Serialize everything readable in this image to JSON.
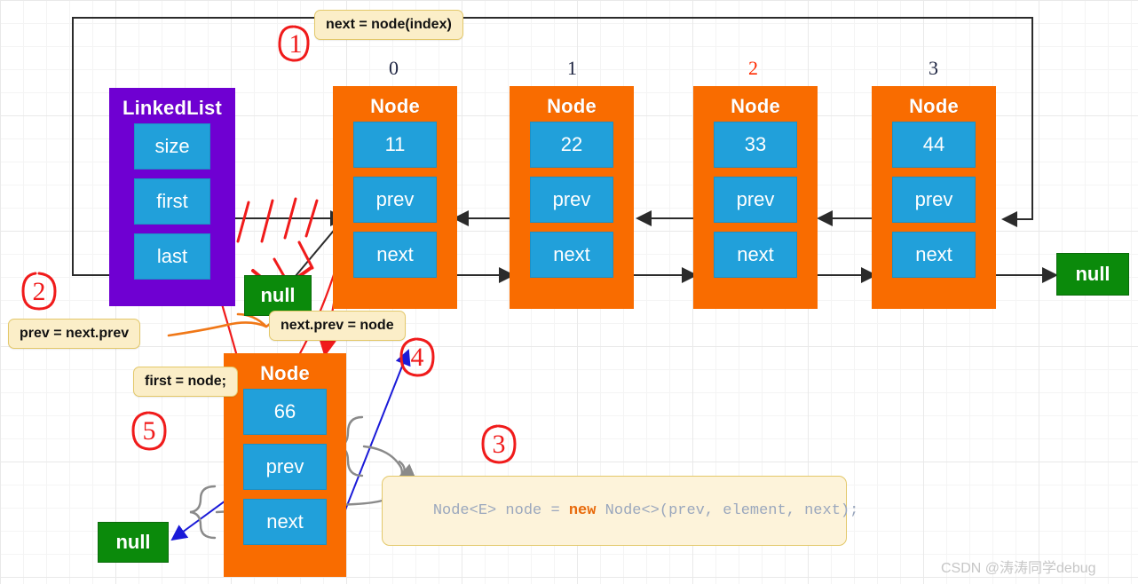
{
  "diagram": {
    "title": "LinkedList add(index, element) doubly-linked list diagram",
    "colors": {
      "linkedlist_box": "#6f00d2",
      "node_box": "#f96c00",
      "field_box": "#21a0da",
      "null_box": "#0b8a0b",
      "note_bg": "#fbeec8",
      "note_border": "#e3c86a",
      "hand_mark": "#f01b1b",
      "highlight_index": "#ff2a00",
      "blue_arrow": "#1a1ad8",
      "orange_arrow": "#f07818",
      "gray_arrow": "#7a7a7a"
    }
  },
  "linkedlist": {
    "title": "LinkedList",
    "fields": [
      {
        "label": "size"
      },
      {
        "label": "first"
      },
      {
        "label": "last"
      }
    ]
  },
  "indices": [
    {
      "label": "0",
      "highlight": false
    },
    {
      "label": "1",
      "highlight": false
    },
    {
      "label": "2",
      "highlight": true
    },
    {
      "label": "3",
      "highlight": false
    }
  ],
  "nodes": [
    {
      "title": "Node",
      "value": "11",
      "prev_label": "prev",
      "next_label": "next"
    },
    {
      "title": "Node",
      "value": "22",
      "prev_label": "prev",
      "next_label": "next"
    },
    {
      "title": "Node",
      "value": "33",
      "prev_label": "prev",
      "next_label": "next"
    },
    {
      "title": "Node",
      "value": "44",
      "prev_label": "prev",
      "next_label": "next"
    }
  ],
  "new_node": {
    "title": "Node",
    "value": "66",
    "prev_label": "prev",
    "next_label": "next"
  },
  "null_boxes": [
    {
      "label": "null",
      "name": "null-right"
    },
    {
      "label": "null",
      "name": "null-crossed-out"
    },
    {
      "label": "null",
      "name": "null-bottom-left"
    }
  ],
  "notes": [
    {
      "text": "next = node(index)",
      "name": "note-next-node-index"
    },
    {
      "text": "prev = next.prev",
      "name": "note-prev-next-prev"
    },
    {
      "text": "next.prev = node",
      "name": "note-next-prev-node"
    },
    {
      "text": "first = node;",
      "name": "note-first-node"
    }
  ],
  "code": {
    "parts": [
      {
        "text": "Node<E>",
        "style": "type"
      },
      {
        "text": " node ",
        "style": "plain"
      },
      {
        "text": "= ",
        "style": "plain"
      },
      {
        "text": "new",
        "style": "kw"
      },
      {
        "text": " Node<>(prev, element, next);",
        "style": "plain"
      }
    ],
    "full": "Node<E> node = new Node<>(prev, element, next);"
  },
  "hand_marks": [
    {
      "label": "1",
      "name": "hand-mark-1"
    },
    {
      "label": "2",
      "name": "hand-mark-2"
    },
    {
      "label": "3",
      "name": "hand-mark-3"
    },
    {
      "label": "4",
      "name": "hand-mark-4"
    },
    {
      "label": "5",
      "name": "hand-mark-5"
    }
  ],
  "watermark": {
    "text": "CSDN @涛涛同学debug"
  }
}
